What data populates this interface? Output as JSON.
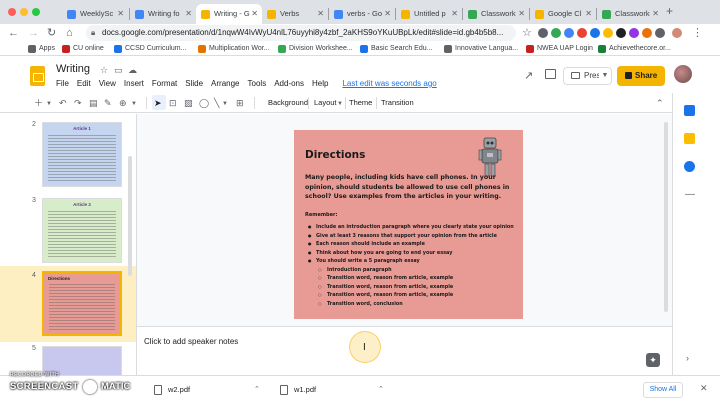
{
  "browser": {
    "tabs": [
      {
        "label": "WeeklySc",
        "color": "#4285f4",
        "active": false
      },
      {
        "label": "Writing fo",
        "color": "#4285f4",
        "active": false
      },
      {
        "label": "Writing - G",
        "color": "#f4b400",
        "active": true
      },
      {
        "label": "Verbs",
        "color": "#f4b400",
        "active": false
      },
      {
        "label": "verbs - Go",
        "color": "#4285f4",
        "active": false
      },
      {
        "label": "Untitled p",
        "color": "#f4b400",
        "active": false
      },
      {
        "label": "Classwork",
        "color": "#34a853",
        "active": false
      },
      {
        "label": "Google Cl",
        "color": "#f4b400",
        "active": false
      },
      {
        "label": "Classwork",
        "color": "#34a853",
        "active": false
      }
    ],
    "new_tab": "+",
    "url": "docs.google.com/presentation/d/1nqwW4IvWyU4nlL76uyyhi8y4zbf_2aKHS9oYKuUBpLk/edit#slide=id.gb4b5b8..."
  },
  "bookmarks": [
    {
      "label": "Apps",
      "color": "#5f6368"
    },
    {
      "label": "CU online",
      "color": "#c5221f"
    },
    {
      "label": "CCSD Curriculum...",
      "color": "#1a73e8"
    },
    {
      "label": "Multiplication Wor...",
      "color": "#e37400"
    },
    {
      "label": "Division Workshee...",
      "color": "#34a853"
    },
    {
      "label": "Basic Search Edu...",
      "color": "#1a73e8"
    },
    {
      "label": "Innovative Langua...",
      "color": "#5f6368"
    },
    {
      "label": "NWEA UAP Login",
      "color": "#c5221f"
    },
    {
      "label": "Achievethecore.or...",
      "color": "#188038"
    }
  ],
  "app": {
    "title": "Writing",
    "menu": [
      "File",
      "Edit",
      "View",
      "Insert",
      "Format",
      "Slide",
      "Arrange",
      "Tools",
      "Add-ons",
      "Help"
    ],
    "last_edit": "Last edit was seconds ago",
    "present_label": "Present",
    "share_label": "Share",
    "brand_color": "#f4b400"
  },
  "toolbar": {
    "background": "Background",
    "layout": "Layout",
    "theme": "Theme",
    "transition": "Transition"
  },
  "filmstrip": {
    "slides": [
      {
        "number": "2",
        "title": "Article 1",
        "color": "#c5d5ef"
      },
      {
        "number": "3",
        "title": "Article 2",
        "color": "#d7ecc9"
      },
      {
        "number": "4",
        "title": "Directions",
        "color": "#e89b94",
        "selected": true
      },
      {
        "number": "5",
        "title": "",
        "color": "#c8c8ee"
      }
    ]
  },
  "slide": {
    "title": "Directions",
    "background": "#e89b94",
    "prompt": "Many people, including kids have cell phones. In your opinion, should students be allowed to use cell phones in school? Use examples from the articles in your writing.",
    "remember_label": "Remember:",
    "bullets": [
      {
        "text": "Include an introduction paragraph where you clearly state your opinion",
        "sub": false
      },
      {
        "text": "Give at least 3 reasons  that support your opinion from the article",
        "sub": false
      },
      {
        "text": "Each reason should include an example",
        "sub": false
      },
      {
        "text": "Think about how you are going to end your essay",
        "sub": false
      },
      {
        "text": "You should write a 5 paragraph essay",
        "sub": false
      },
      {
        "text": "Introduction paragraph",
        "sub": true
      },
      {
        "text": "Transition word, reason from article, example",
        "sub": true
      },
      {
        "text": "Transition word, reason from article, example",
        "sub": true
      },
      {
        "text": "Transition word, reason from article, example",
        "sub": true
      },
      {
        "text": "Transition word, conclusion",
        "sub": true
      }
    ]
  },
  "notes": {
    "placeholder": "Click to add speaker notes"
  },
  "downloads": {
    "items": [
      {
        "name": "w2.pdf"
      },
      {
        "name": "w1.pdf"
      }
    ],
    "show_all": "Show All"
  },
  "watermark": {
    "recorded_with": "RECORDED WITH",
    "brand_left": "SCREENCAST",
    "brand_right": "MATIC"
  }
}
